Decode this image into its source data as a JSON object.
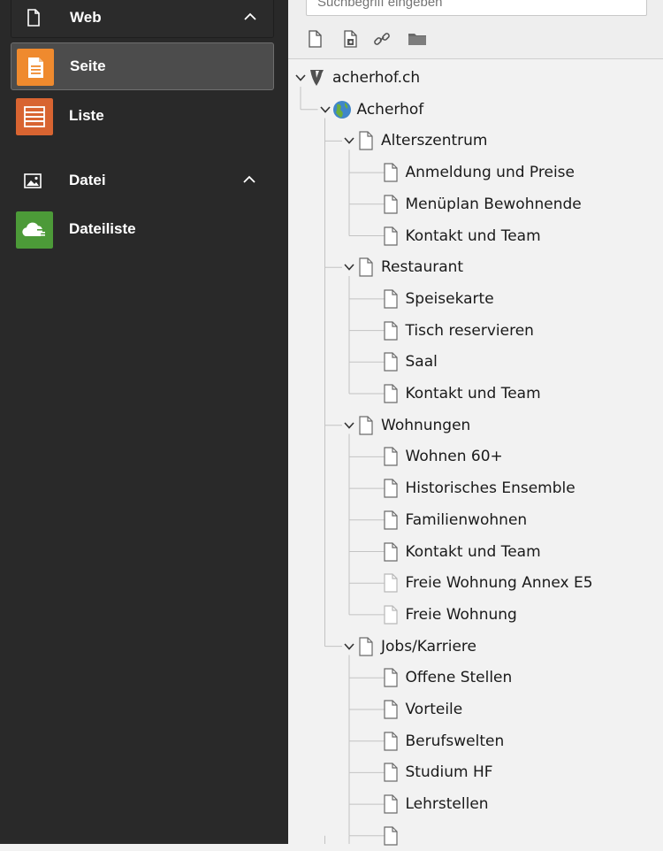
{
  "sidebar": {
    "groups": [
      {
        "label": "Web",
        "icon": "page-icon",
        "collapse_icon": "chevron-up-icon"
      },
      {
        "label": "Datei",
        "icon": "image-icon",
        "collapse_icon": "chevron-up-icon"
      }
    ],
    "modules": [
      {
        "label": "Seite",
        "icon": "page-module-icon",
        "color": "#ef8a2e",
        "active": true
      },
      {
        "label": "Liste",
        "icon": "list-module-icon",
        "color": "#d86431",
        "active": false
      },
      {
        "label": "Dateiliste",
        "icon": "cloud-module-icon",
        "color": "#4c9a38",
        "active": false
      }
    ]
  },
  "toolbar": {
    "search_placeholder": "Suchbegriff eingeben",
    "buttons": [
      "new-page-icon",
      "new-page-import-icon",
      "link-icon",
      "folder-icon"
    ]
  },
  "tree": [
    {
      "label": "acherhof.ch",
      "level": 0,
      "icon": "typo3-logo-icon",
      "expanded": true
    },
    {
      "label": "Acherhof",
      "level": 1,
      "icon": "globe-icon",
      "expanded": true
    },
    {
      "label": "Alterszentrum",
      "level": 2,
      "icon": "page-icon",
      "expanded": true
    },
    {
      "label": "Anmeldung und Preise",
      "level": 3,
      "icon": "page-icon"
    },
    {
      "label": "Menüplan Bewohnende",
      "level": 3,
      "icon": "page-icon"
    },
    {
      "label": "Kontakt und Team",
      "level": 3,
      "icon": "page-icon"
    },
    {
      "label": "Restaurant",
      "level": 2,
      "icon": "page-icon",
      "expanded": true
    },
    {
      "label": "Speisekarte",
      "level": 3,
      "icon": "page-icon"
    },
    {
      "label": "Tisch reservieren",
      "level": 3,
      "icon": "page-icon"
    },
    {
      "label": "Saal",
      "level": 3,
      "icon": "page-icon"
    },
    {
      "label": "Kontakt und Team",
      "level": 3,
      "icon": "page-icon"
    },
    {
      "label": "Wohnungen",
      "level": 2,
      "icon": "page-icon",
      "expanded": true
    },
    {
      "label": "Wohnen 60+",
      "level": 3,
      "icon": "page-icon"
    },
    {
      "label": "Historisches Ensemble",
      "level": 3,
      "icon": "page-icon"
    },
    {
      "label": "Familienwohnen",
      "level": 3,
      "icon": "page-icon"
    },
    {
      "label": "Kontakt und Team",
      "level": 3,
      "icon": "page-icon"
    },
    {
      "label": "Freie Wohnung Annex E5",
      "level": 3,
      "icon": "page-hidden-icon"
    },
    {
      "label": "Freie Wohnung",
      "level": 3,
      "icon": "page-hidden-icon"
    },
    {
      "label": "Jobs/Karriere",
      "level": 2,
      "icon": "page-icon",
      "expanded": true
    },
    {
      "label": "Offene Stellen",
      "level": 3,
      "icon": "page-icon"
    },
    {
      "label": "Vorteile",
      "level": 3,
      "icon": "page-icon"
    },
    {
      "label": "Berufswelten",
      "level": 3,
      "icon": "page-icon"
    },
    {
      "label": "Studium HF",
      "level": 3,
      "icon": "page-icon"
    },
    {
      "label": "Lehrstellen",
      "level": 3,
      "icon": "page-icon"
    },
    {
      "label": "",
      "level": 3,
      "icon": "page-icon"
    }
  ]
}
